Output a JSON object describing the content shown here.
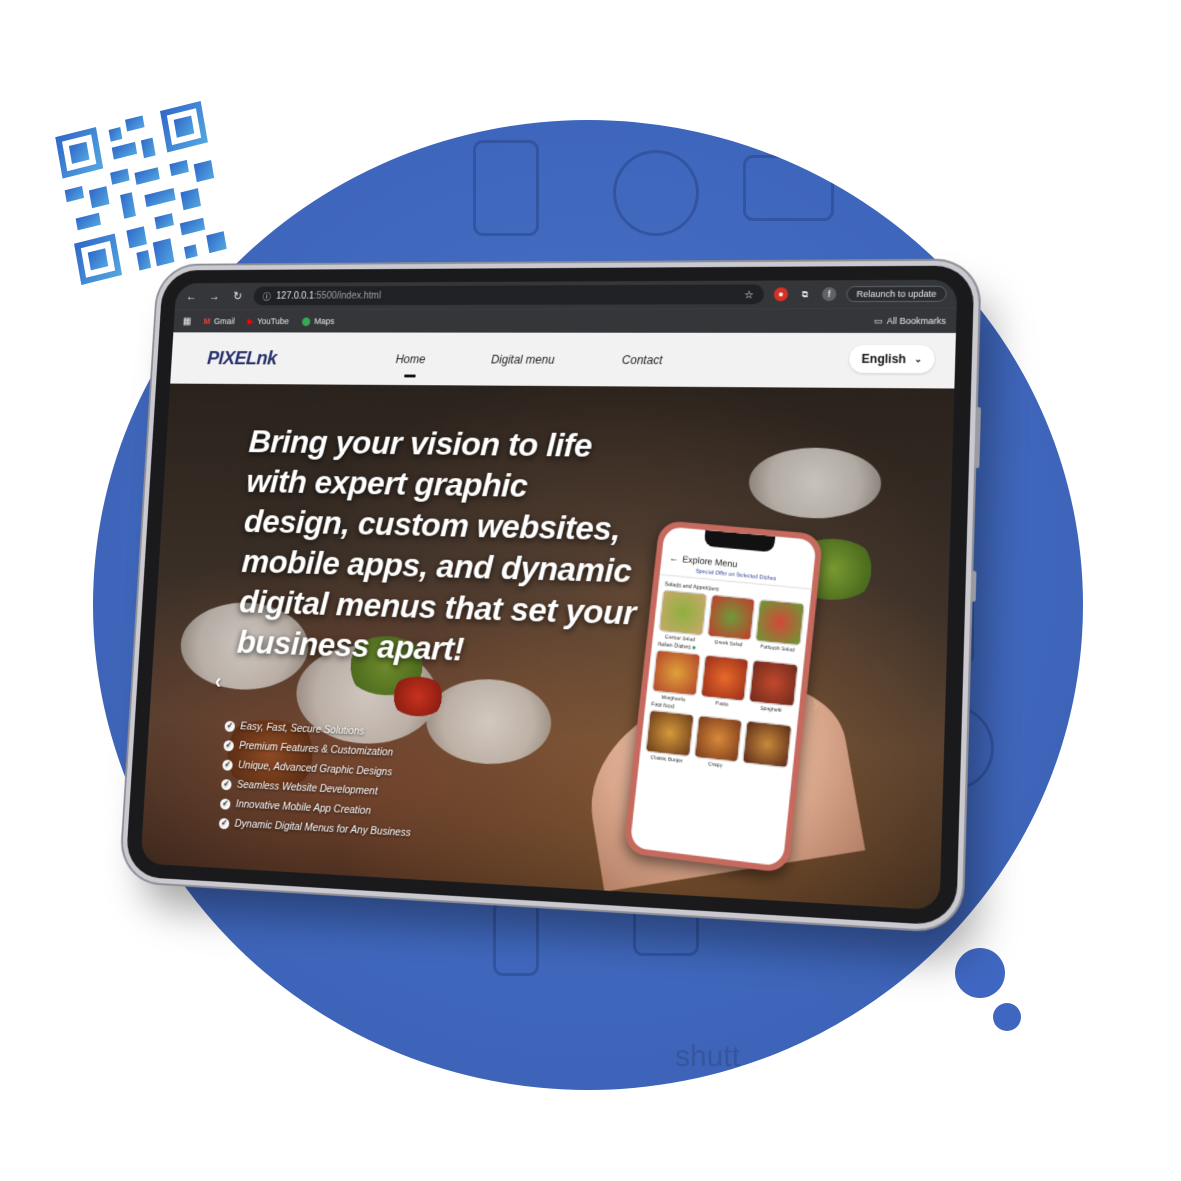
{
  "browser": {
    "url_host": "127.0.0.1",
    "url_path": ":5500/index.html",
    "relaunch_label": "Relaunch to update",
    "profile_initial": "f",
    "bookmarks": [
      {
        "label": "Gmail",
        "icon": "gmail-icon"
      },
      {
        "label": "YouTube",
        "icon": "youtube-icon"
      },
      {
        "label": "Maps",
        "icon": "maps-icon"
      }
    ],
    "all_bookmarks_label": "All Bookmarks"
  },
  "site": {
    "logo": "PIXELnk",
    "nav": [
      {
        "label": "Home",
        "active": true
      },
      {
        "label": "Digital menu",
        "active": false
      },
      {
        "label": "Contact",
        "active": false
      }
    ],
    "language": "English",
    "headline": "Bring your vision to life with expert graphic design, custom websites, mobile apps, and dynamic digital menus that set your business apart!",
    "features": [
      "Easy, Fast, Secure Solutions",
      "Premium Features & Customization",
      "Unique, Advanced Graphic Designs",
      "Seamless Website Development",
      "Innovative Mobile App Creation",
      "Dynamic Digital Menus for Any Business"
    ]
  },
  "phone": {
    "title": "Explore Menu",
    "special": "Special Offer on Selected Dishes",
    "sections": [
      {
        "name": "Salads and Appetizers",
        "dishes": [
          "Caesar Salad",
          "Greek Salad",
          "Fattoush Salad"
        ]
      },
      {
        "name": "Italian Dishes",
        "dishes": [
          "Margherita",
          "Pasta",
          "Spaghetti"
        ]
      },
      {
        "name": "Fast food",
        "dishes": [
          "Classic Burger",
          "Crispy",
          ""
        ]
      }
    ]
  },
  "watermark": "shutt",
  "colors": {
    "accent": "#3f67bd",
    "logo": "#26306b",
    "phone_case": "#c66a5f"
  }
}
